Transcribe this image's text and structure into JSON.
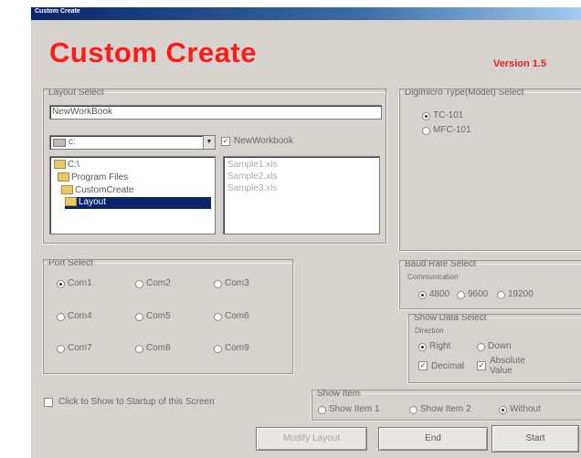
{
  "window": {
    "title": "Custom Create"
  },
  "header": {
    "title": "Custom Create",
    "version": "Version 1.5"
  },
  "layout_select": {
    "legend": "Layout Select",
    "workbook_name": "NewWorkBook",
    "drive": "c:",
    "new_workbook_label": "NewWorkbook",
    "new_workbook_checked": true,
    "folders": [
      "C:\\",
      "Program Files",
      "CustomCreate",
      "Layout"
    ],
    "files": [
      "Sample1.xls",
      "Sample2.xls",
      "Sample3.xls"
    ]
  },
  "digimicro_select": {
    "legend": "Digimicro Type(Model) Select",
    "options": [
      "TC-101",
      "MFC-101"
    ],
    "selected": "TC-101"
  },
  "port_select": {
    "legend": "Port Select",
    "ports": [
      "Com1",
      "Com2",
      "Com3",
      "Com4",
      "Com5",
      "Com6",
      "Com7",
      "Com8",
      "Com9"
    ],
    "selected": "Com1"
  },
  "baud_rate": {
    "legend": "Baud Rate Select",
    "caption": "Communication",
    "options": [
      "4800",
      "9600",
      "19200"
    ],
    "selected": "4800"
  },
  "show_data": {
    "legend": "Show Data Select",
    "caption": "Direction",
    "direction_options": [
      "Right",
      "Down"
    ],
    "direction_selected": "Right",
    "decimal_label": "Decimal",
    "absolute_label_1": "Absolute",
    "absolute_label_2": "Value"
  },
  "show_item": {
    "legend": "Show Item",
    "options": [
      "Show Item 1",
      "Show Item 2",
      "Without"
    ],
    "selected": "Without"
  },
  "startup": {
    "label": "Click to Show to Startup of this Screen"
  },
  "buttons": {
    "modify_layout": "Modify Layout",
    "end": "End",
    "start": "Start"
  }
}
